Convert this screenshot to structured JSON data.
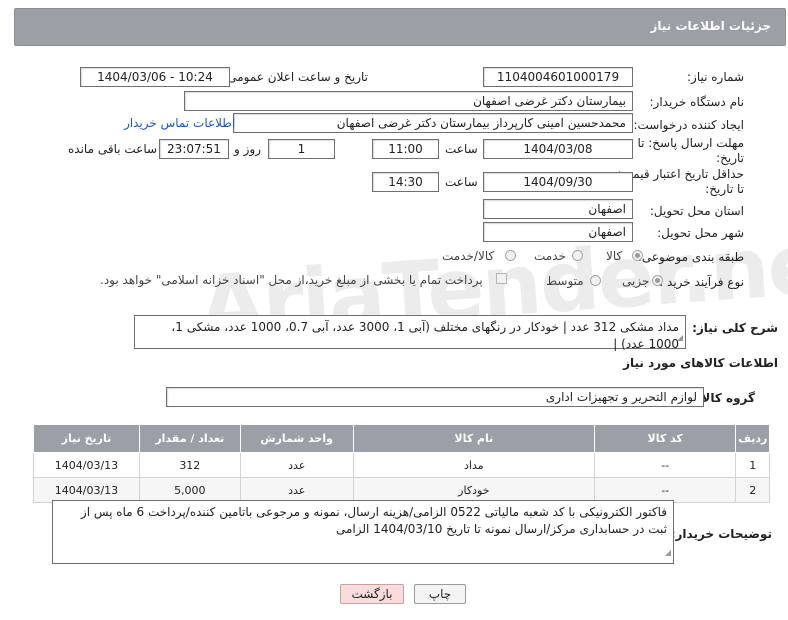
{
  "header": {
    "title": "جزئیات اطلاعات نیاز"
  },
  "form": {
    "need_number_label": "شماره نیاز:",
    "need_number": "1104004601000179",
    "announce_label": "تاریخ و ساعت اعلان عمومی:",
    "announce_value": "1404/03/06 - 10:24",
    "buyer_org_label": "نام دستگاه خریدار:",
    "buyer_org": "بیمارستان دکتر غرضی اصفهان",
    "requester_label": "ایجاد کننده درخواست:",
    "requester": "محمدحسین امینی کارپرداز بیمارستان دکتر غرضی اصفهان",
    "contact_link": "اطلاعات تماس خریدار",
    "deadline_label": "مهلت ارسال پاسخ: تا تاریخ:",
    "deadline_date": "1404/03/08",
    "time_label": "ساعت",
    "deadline_time": "11:00",
    "days_value": "1",
    "days_label": "روز و",
    "remaining_time": "23:07:51",
    "remaining_label": "ساعت باقی مانده",
    "validity_label": "حداقل تاریخ اعتبار قیمت: تا تاریخ:",
    "validity_date": "1404/09/30",
    "validity_time": "14:30",
    "province_label": "استان محل تحویل:",
    "province": "اصفهان",
    "city_label": "شهر محل تحویل:",
    "city": "اصفهان",
    "category_label": "طبقه بندی موضوعی:",
    "category_options": [
      "کالا",
      "خدمت",
      "کالا/خدمت"
    ],
    "process_label": "نوع فرآیند خرید :",
    "process_options": [
      "جزیی",
      "متوسط"
    ],
    "payment_note": "پرداخت تمام یا بخشی از مبلغ خرید،از محل \"اسناد خزانه اسلامی\" خواهد بود.",
    "description_label": "شرح کلی نیاز:",
    "description": "مداد مشکی 312 عدد | خودکار در رنگهای مختلف (آبی 1، 3000 عدد، آبی 0.7، 1000 عدد، مشکی 1، 1000 عدد) |",
    "goods_info_title": "اطلاعات کالاهای مورد نیاز",
    "goods_group_label": "گروه کالا:",
    "goods_group": "لوازم التحریر و تجهیزات اداری",
    "buyer_notes_label": "توضیحات خریدار:",
    "buyer_notes": "فاکتور الکترونیکی با کد شعبه مالیاتی 0522 الزامی/هزینه ارسال، نمونه و مرجوعی باتامین کننده/پرداخت 6 ماه پس از ثبت در حسابداری مرکز/ارسال نمونه تا تاریخ 1404/03/10 الزامی"
  },
  "table": {
    "headers": [
      "ردیف",
      "کد کالا",
      "نام کالا",
      "واحد شمارش",
      "تعداد / مقدار",
      "تاریخ نیاز"
    ],
    "rows": [
      [
        "1",
        "--",
        "مداد",
        "عدد",
        "312",
        "1404/03/13"
      ],
      [
        "2",
        "--",
        "خودکار",
        "عدد",
        "5,000",
        "1404/03/13"
      ]
    ]
  },
  "buttons": {
    "print": "چاپ",
    "back": "بازگشت"
  },
  "watermark": "AriaTender.neT"
}
